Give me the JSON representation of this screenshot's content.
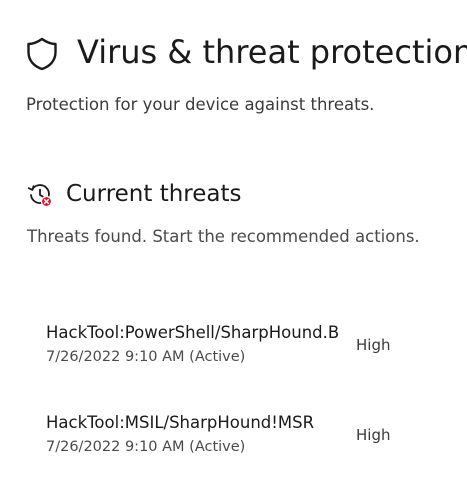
{
  "header": {
    "title": "Virus & threat protection",
    "subtitle": "Protection for your device against threats.",
    "icon": "shield-icon"
  },
  "current_threats": {
    "title": "Current threats",
    "description": "Threats found. Start the recommended actions.",
    "icon": "threat-history-icon",
    "alert_color": "#e81123",
    "items": [
      {
        "name": "HackTool:PowerShell/SharpHound.B",
        "time": "7/26/2022 9:10 AM (Active)",
        "severity": "High"
      },
      {
        "name": "HackTool:MSIL/SharpHound!MSR",
        "time": "7/26/2022 9:10 AM (Active)",
        "severity": "High"
      }
    ]
  }
}
